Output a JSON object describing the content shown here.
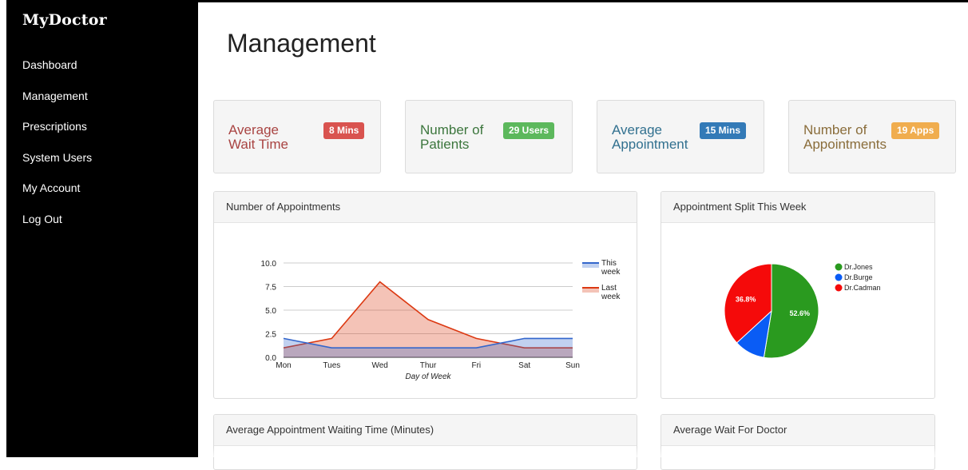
{
  "sidebar": {
    "brand": "MyDoctor",
    "items": [
      {
        "label": "Dashboard"
      },
      {
        "label": "Management"
      },
      {
        "label": "Prescriptions"
      },
      {
        "label": "System Users"
      },
      {
        "label": "My Account"
      },
      {
        "label": "Log Out"
      }
    ]
  },
  "page": {
    "title": "Management"
  },
  "stats": [
    {
      "line1": "Average",
      "line2": "Wait Time",
      "badge": "8 Mins",
      "color": "#a94442",
      "badge_color": "#d9534f"
    },
    {
      "line1": "Number of",
      "line2": "Patients",
      "badge": "29 Users",
      "color": "#3c763d",
      "badge_color": "#5cb85c"
    },
    {
      "line1": "Average",
      "line2": "Appointment",
      "badge": "15 Mins",
      "color": "#31708f",
      "badge_color": "#337ab7"
    },
    {
      "line1": "Number of",
      "line2": "Appointments",
      "badge": "19 Apps",
      "color": "#8a6d3b",
      "badge_color": "#f0ad4e"
    }
  ],
  "panels": {
    "appointments": "Number of Appointments",
    "split": "Appointment Split This Week",
    "waiting": "Average Appointment Waiting Time (Minutes)",
    "wait_doctor": "Average Wait For Doctor"
  },
  "chart_data": [
    {
      "type": "area",
      "title": "Number of Appointments",
      "xlabel": "Day of Week",
      "ylabel": "",
      "categories": [
        "Mon",
        "Tues",
        "Wed",
        "Thur",
        "Fri",
        "Sat",
        "Sun"
      ],
      "ylim": [
        0,
        10
      ],
      "yticks": [
        "10.0",
        "7.5",
        "5.0",
        "2.5",
        "0.0"
      ],
      "grid": true,
      "legend_position": "right",
      "series": [
        {
          "name": "This week",
          "values": [
            2,
            1,
            1,
            1,
            1,
            2,
            2
          ],
          "color": "#3366cc"
        },
        {
          "name": "Last week",
          "values": [
            1,
            2,
            8,
            4,
            2,
            1,
            1
          ],
          "color": "#dc3912"
        }
      ]
    },
    {
      "type": "pie",
      "title": "Appointment Split This Week",
      "legend_position": "right",
      "slices": [
        {
          "label": "Dr.Jones",
          "value": 52.6,
          "display": "52.6%",
          "color": "#2a9a1f"
        },
        {
          "label": "Dr.Burge",
          "value": 10.6,
          "display": "",
          "color": "#0a5cf5"
        },
        {
          "label": "Dr.Cadman",
          "value": 36.8,
          "display": "36.8%",
          "color": "#f50a0a"
        }
      ]
    }
  ]
}
